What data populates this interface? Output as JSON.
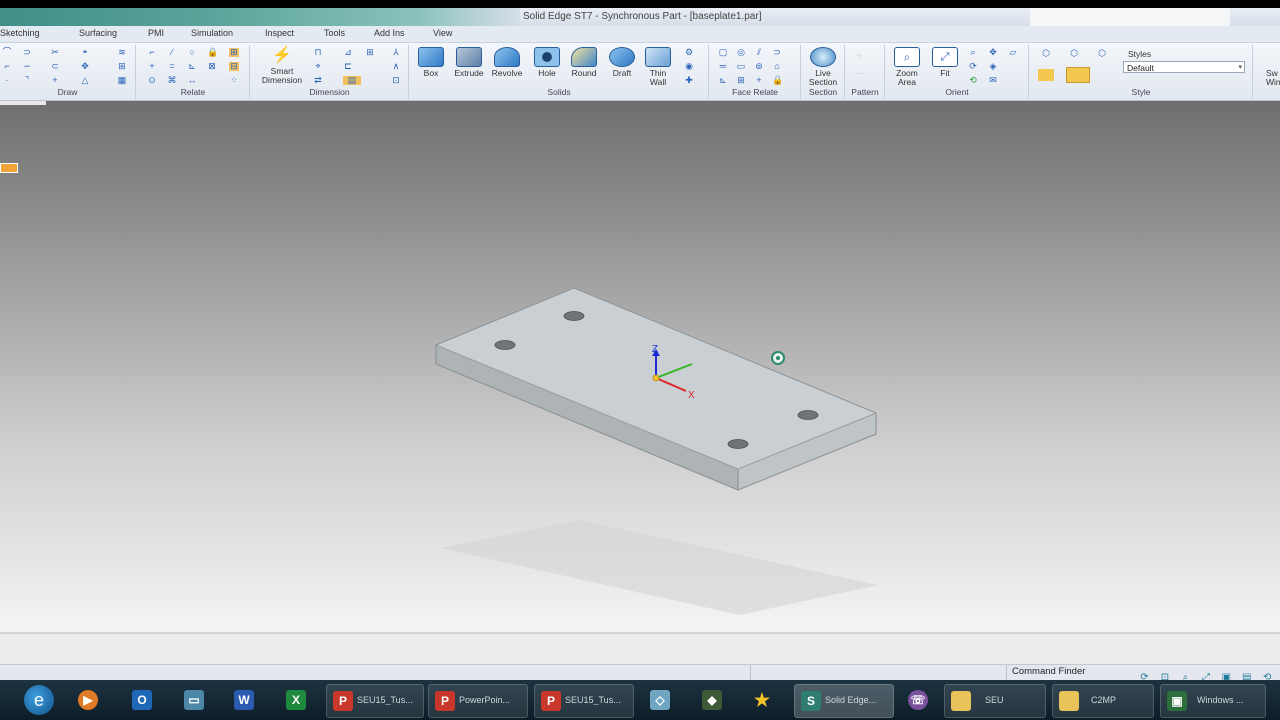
{
  "window": {
    "title": "Solid Edge ST7 - Synchronous Part - [baseplate1.par]"
  },
  "menu": {
    "items": [
      "Sketching",
      "Surfacing",
      "PMI",
      "Simulation",
      "Inspect",
      "Tools",
      "Add Ins",
      "View"
    ]
  },
  "ribbon": {
    "groups": {
      "draw": "Draw",
      "relate": "Relate",
      "dimension": "Dimension",
      "solids": "Solids",
      "face_relate": "Face Relate",
      "section": "Section",
      "pattern": "Pattern",
      "orient": "Orient",
      "style": "Style"
    },
    "buttons": {
      "smart_dimension": "Smart Dimension",
      "box": "Box",
      "extrude": "Extrude",
      "revolve": "Revolve",
      "hole": "Hole",
      "round": "Round",
      "draft": "Draft",
      "thin_wall": "Thin Wall",
      "live_section": "Live Section",
      "zoom_area": "Zoom Area",
      "fit": "Fit"
    },
    "styles": {
      "label": "Styles",
      "value": "Default"
    },
    "right_partial": "Sw Win"
  },
  "viewport": {
    "axes": {
      "z": "Z",
      "x": "X"
    }
  },
  "statusbar": {
    "command_finder": "Command Finder"
  },
  "taskbar": {
    "items": [
      {
        "label": "SEU15_Tus..."
      },
      {
        "label": "PowerPoin..."
      },
      {
        "label": "SEU15_Tus..."
      },
      {
        "label": "Solid Edge..."
      },
      {
        "label": "SEU"
      },
      {
        "label": "C2MP"
      },
      {
        "label": "Windows ..."
      }
    ]
  },
  "colors": {
    "plate_top": "#c9cfd2",
    "plate_side": "#aeb3b6",
    "axis_z": "#1a2bd6",
    "axis_x": "#e0262a",
    "axis_y": "#34b524",
    "taskbar": "#14283a"
  }
}
